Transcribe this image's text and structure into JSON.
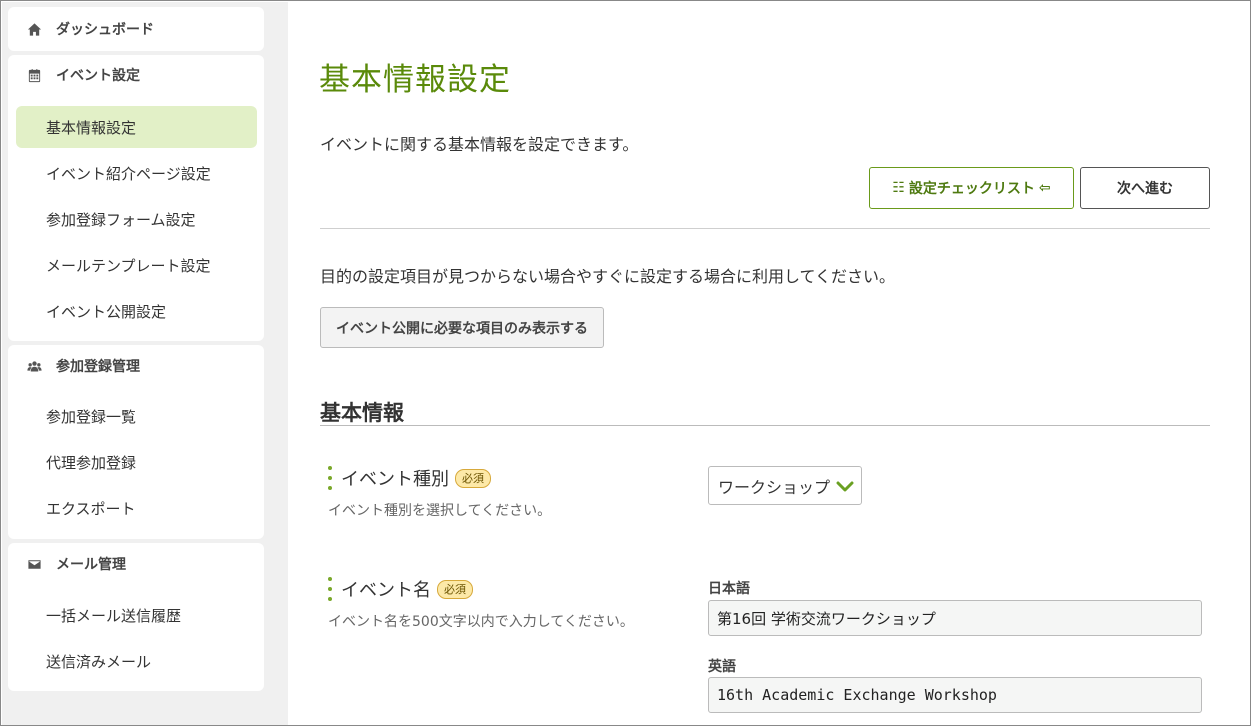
{
  "sidebar": {
    "dashboard": {
      "label": "ダッシュボード",
      "icon": "home-icon"
    },
    "event_settings": {
      "label": "イベント設定",
      "icon": "calendar-icon",
      "items": [
        "基本情報設定",
        "イベント紹介ページ設定",
        "参加登録フォーム設定",
        "メールテンプレート設定",
        "イベント公開設定"
      ],
      "active_index": 0
    },
    "registration": {
      "label": "参加登録管理",
      "icon": "users-icon",
      "items": [
        "参加登録一覧",
        "代理参加登録",
        "エクスポート"
      ]
    },
    "mail": {
      "label": "メール管理",
      "icon": "envelope-icon",
      "items": [
        "一括メール送信履歴",
        "送信済みメール"
      ]
    }
  },
  "main": {
    "title": "基本情報設定",
    "description": "イベントに関する基本情報を設定できます。",
    "checklist_button": "設定チェックリスト",
    "next_button": "次へ進む",
    "note": "目的の設定項目が見つからない場合やすぐに設定する場合に利用してください。",
    "filter_button": "イベント公開に必要な項目のみ表示する",
    "section_title": "基本情報",
    "required_badge": "必須",
    "fields": {
      "event_type": {
        "label": "イベント種別",
        "help": "イベント種別を選択してください。",
        "value": "ワークショップ"
      },
      "event_name": {
        "label": "イベント名",
        "help": "イベント名を500文字以内で入力してください。",
        "ja_label": "日本語",
        "ja_value": "第16回 学術交流ワークショップ",
        "en_label": "英語",
        "en_value": "16th Academic Exchange Workshop"
      }
    }
  },
  "colors": {
    "accent": "#5a8a0a",
    "active_bg": "#e2f0c7",
    "badge_bg": "#fde9a8",
    "sidebar_bg": "#f0f0f0"
  }
}
